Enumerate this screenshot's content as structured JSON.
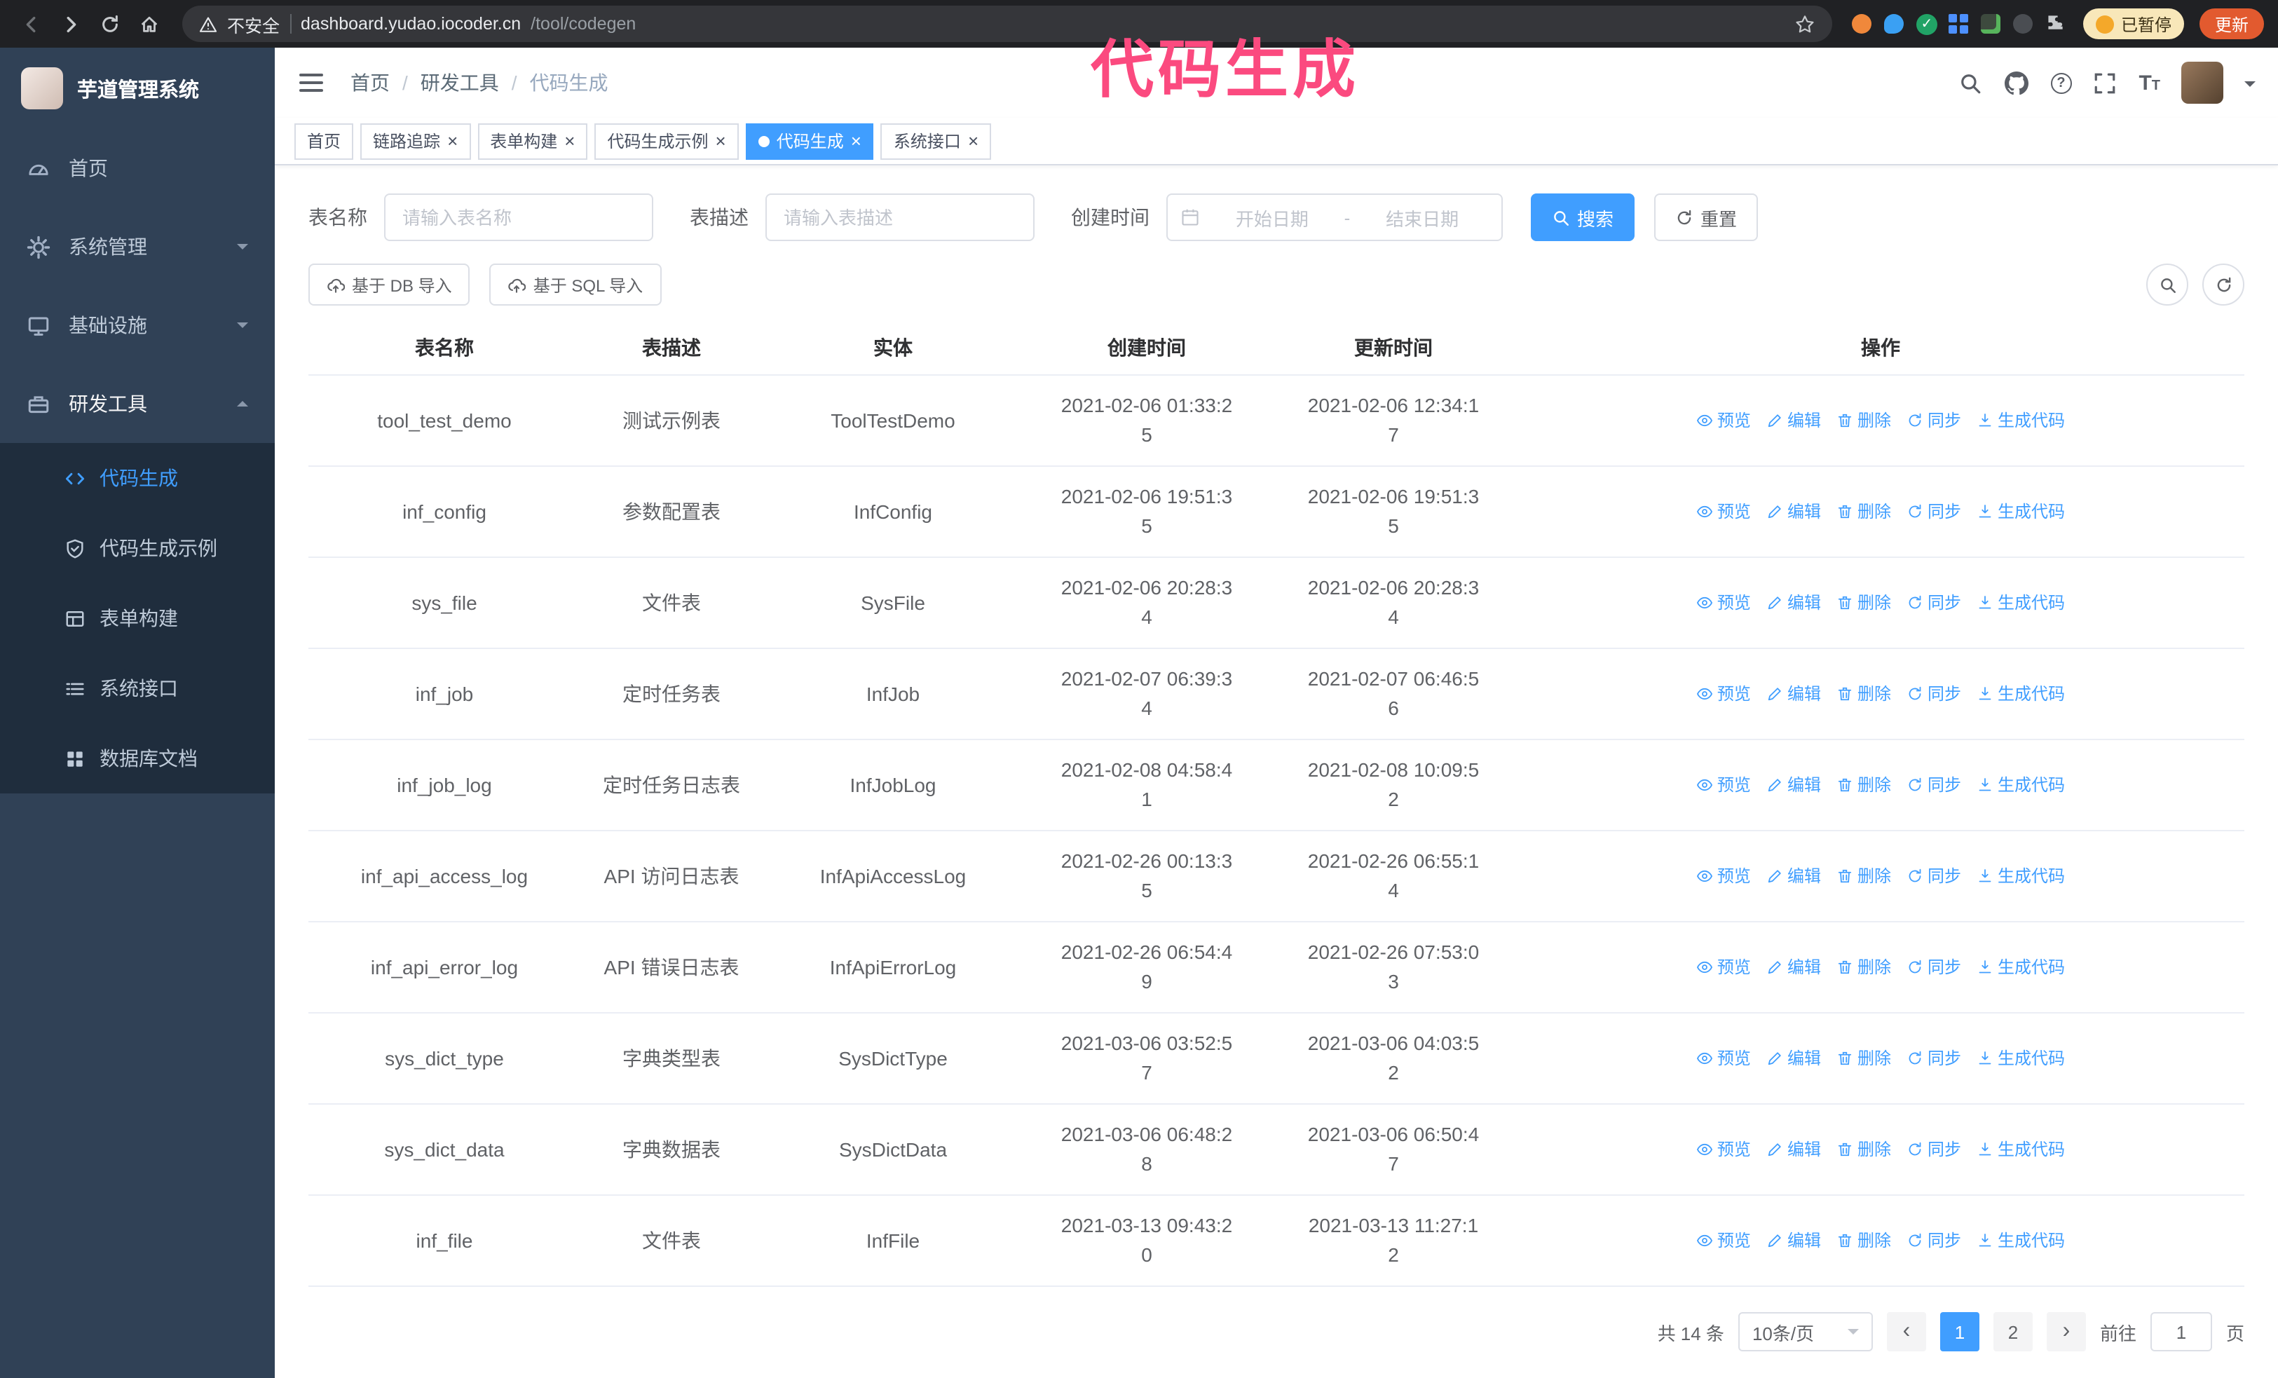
{
  "colors": {
    "accent": "#409eff",
    "annotation": "#fb4a7f",
    "sidebar_bg": "#304156",
    "submenu_bg": "#1f2d3d",
    "update_button_bg": "#e25a2f",
    "paused_badge_bg": "#f8e7b9"
  },
  "annotation": {
    "text": "代码生成"
  },
  "browser": {
    "security_label": "不安全",
    "url_domain": "dashboard.yudao.iocoder.cn",
    "url_path": "/tool/codegen",
    "paused_badge": "已暂停",
    "update_button": "更新"
  },
  "sidebar": {
    "logo_title": "芋道管理系统",
    "items": [
      {
        "label": "首页"
      },
      {
        "label": "系统管理"
      },
      {
        "label": "基础设施"
      },
      {
        "label": "研发工具"
      }
    ],
    "dev_tools_children": [
      {
        "label": "代码生成"
      },
      {
        "label": "代码生成示例"
      },
      {
        "label": "表单构建"
      },
      {
        "label": "系统接口"
      },
      {
        "label": "数据库文档"
      }
    ]
  },
  "header": {
    "breadcrumb": [
      "首页",
      "研发工具",
      "代码生成"
    ]
  },
  "tabs": [
    {
      "label": "首页"
    },
    {
      "label": "链路追踪"
    },
    {
      "label": "表单构建"
    },
    {
      "label": "代码生成示例"
    },
    {
      "label": "代码生成"
    },
    {
      "label": "系统接口"
    }
  ],
  "filters": {
    "table_name_label": "表名称",
    "table_name_placeholder": "请输入表名称",
    "table_desc_label": "表描述",
    "table_desc_placeholder": "请输入表描述",
    "create_time_label": "创建时间",
    "date_start_placeholder": "开始日期",
    "date_separator": "-",
    "date_end_placeholder": "结束日期",
    "search_button": "搜索",
    "reset_button": "重置"
  },
  "toolbar": {
    "import_db": "基于 DB 导入",
    "import_sql": "基于 SQL 导入"
  },
  "table": {
    "columns": [
      "表名称",
      "表描述",
      "实体",
      "创建时间",
      "更新时间",
      "操作"
    ],
    "actions": [
      "预览",
      "编辑",
      "删除",
      "同步",
      "生成代码"
    ],
    "rows": [
      {
        "name": "tool_test_demo",
        "desc": "测试示例表",
        "entity": "ToolTestDemo",
        "created": "2021-02-06 01:33:25",
        "updated": "2021-02-06 12:34:17"
      },
      {
        "name": "inf_config",
        "desc": "参数配置表",
        "entity": "InfConfig",
        "created": "2021-02-06 19:51:35",
        "updated": "2021-02-06 19:51:35"
      },
      {
        "name": "sys_file",
        "desc": "文件表",
        "entity": "SysFile",
        "created": "2021-02-06 20:28:34",
        "updated": "2021-02-06 20:28:34"
      },
      {
        "name": "inf_job",
        "desc": "定时任务表",
        "entity": "InfJob",
        "created": "2021-02-07 06:39:34",
        "updated": "2021-02-07 06:46:56"
      },
      {
        "name": "inf_job_log",
        "desc": "定时任务日志表",
        "entity": "InfJobLog",
        "created": "2021-02-08 04:58:41",
        "updated": "2021-02-08 10:09:52"
      },
      {
        "name": "inf_api_access_log",
        "desc": "API 访问日志表",
        "entity": "InfApiAccessLog",
        "created": "2021-02-26 00:13:35",
        "updated": "2021-02-26 06:55:14"
      },
      {
        "name": "inf_api_error_log",
        "desc": "API 错误日志表",
        "entity": "InfApiErrorLog",
        "created": "2021-02-26 06:54:49",
        "updated": "2021-02-26 07:53:03"
      },
      {
        "name": "sys_dict_type",
        "desc": "字典类型表",
        "entity": "SysDictType",
        "created": "2021-03-06 03:52:57",
        "updated": "2021-03-06 04:03:52"
      },
      {
        "name": "sys_dict_data",
        "desc": "字典数据表",
        "entity": "SysDictData",
        "created": "2021-03-06 06:48:28",
        "updated": "2021-03-06 06:50:47"
      },
      {
        "name": "inf_file",
        "desc": "文件表",
        "entity": "InfFile",
        "created": "2021-03-13 09:43:20",
        "updated": "2021-03-13 11:27:12"
      }
    ]
  },
  "pagination": {
    "total": "共 14 条",
    "page_size": "10条/页",
    "page_1": "1",
    "page_2": "2",
    "goto_label": "前往",
    "goto_value": "1",
    "unit_label": "页"
  }
}
